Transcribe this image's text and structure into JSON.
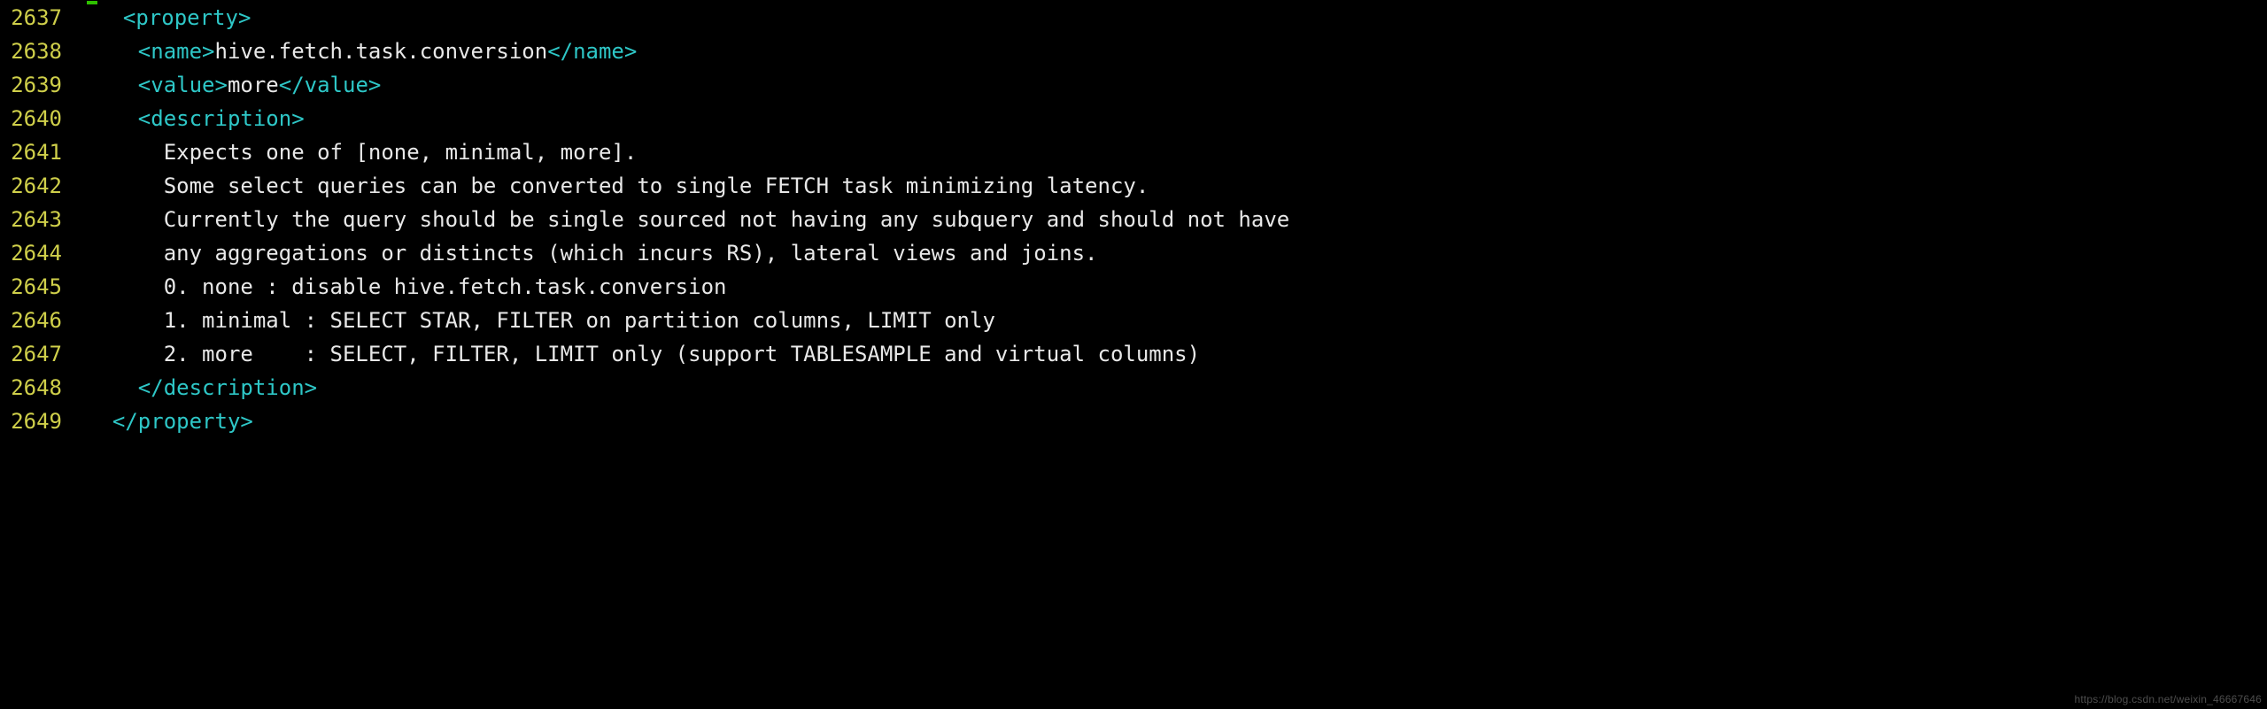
{
  "watermark": "https://blog.csdn.net/weixin_46667646",
  "lines": [
    {
      "num": "2637",
      "cursor": true,
      "segments": [
        {
          "t": "  ",
          "c": "txt"
        },
        {
          "t": "<property>",
          "c": "tag"
        }
      ]
    },
    {
      "num": "2638",
      "segments": [
        {
          "t": "    ",
          "c": "txt"
        },
        {
          "t": "<name>",
          "c": "tag"
        },
        {
          "t": "hive.fetch.task.conversion",
          "c": "txt"
        },
        {
          "t": "</name>",
          "c": "tag"
        }
      ]
    },
    {
      "num": "2639",
      "segments": [
        {
          "t": "    ",
          "c": "txt"
        },
        {
          "t": "<value>",
          "c": "tag"
        },
        {
          "t": "more",
          "c": "txt"
        },
        {
          "t": "</value>",
          "c": "tag"
        }
      ]
    },
    {
      "num": "2640",
      "segments": [
        {
          "t": "    ",
          "c": "txt"
        },
        {
          "t": "<description>",
          "c": "tag"
        }
      ]
    },
    {
      "num": "2641",
      "segments": [
        {
          "t": "      Expects one of [none, minimal, more].",
          "c": "txt"
        }
      ]
    },
    {
      "num": "2642",
      "segments": [
        {
          "t": "      Some select queries can be converted to single FETCH task minimizing latency.",
          "c": "txt"
        }
      ]
    },
    {
      "num": "2643",
      "segments": [
        {
          "t": "      Currently the query should be single sourced not having any subquery and should not have",
          "c": "txt"
        }
      ]
    },
    {
      "num": "2644",
      "segments": [
        {
          "t": "      any aggregations or distincts (which incurs RS), lateral views and joins.",
          "c": "txt"
        }
      ]
    },
    {
      "num": "2645",
      "segments": [
        {
          "t": "      0. none : disable hive.fetch.task.conversion",
          "c": "txt"
        }
      ]
    },
    {
      "num": "2646",
      "segments": [
        {
          "t": "      1. minimal : SELECT STAR, FILTER on partition columns, LIMIT only",
          "c": "txt"
        }
      ]
    },
    {
      "num": "2647",
      "segments": [
        {
          "t": "      2. more    : SELECT, FILTER, LIMIT only (support TABLESAMPLE and virtual columns)",
          "c": "txt"
        }
      ]
    },
    {
      "num": "2648",
      "segments": [
        {
          "t": "    ",
          "c": "txt"
        },
        {
          "t": "</description>",
          "c": "tag"
        }
      ]
    },
    {
      "num": "2649",
      "segments": [
        {
          "t": "  ",
          "c": "txt"
        },
        {
          "t": "</property>",
          "c": "tag"
        }
      ]
    }
  ]
}
